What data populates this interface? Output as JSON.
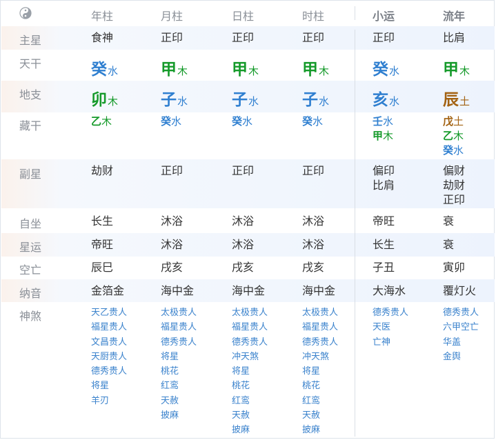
{
  "colors": {
    "water": "#2f7fd0",
    "wood": "#159a2a",
    "earth": "#a36212",
    "shensha": "#3a82cc",
    "label": "#8a8f97"
  },
  "header": {
    "icon": "yin-yang-icon",
    "year": "年柱",
    "month": "月柱",
    "day": "日柱",
    "hour": "时柱",
    "xiaoyun": "小运",
    "liunian": "流年"
  },
  "rows": {
    "zhuxing": "主星",
    "tiangan": "天干",
    "dizhi": "地支",
    "canggan": "藏干",
    "fuxing": "副星",
    "zizuo": "自坐",
    "xingyun": "星运",
    "kongwang": "空亡",
    "nayin": "纳音",
    "shensha": "神煞"
  },
  "columns": [
    {
      "zhuxing": "食神",
      "gan": {
        "char": "癸",
        "el": "水",
        "color": "water"
      },
      "zhi": {
        "char": "卯",
        "el": "木",
        "color": "wood"
      },
      "canggan": [
        {
          "char": "乙",
          "el": "木",
          "color": "wood"
        }
      ],
      "fuxing": [
        "劫财"
      ],
      "zizuo": "长生",
      "xingyun": "帝旺",
      "kongwang": "辰巳",
      "nayin": "金箔金",
      "shensha": [
        "天乙贵人",
        "福星贵人",
        "文昌贵人",
        "天厨贵人",
        "德秀贵人",
        "将星",
        "羊刃"
      ]
    },
    {
      "zhuxing": "正印",
      "gan": {
        "char": "甲",
        "el": "木",
        "color": "wood"
      },
      "zhi": {
        "char": "子",
        "el": "水",
        "color": "water"
      },
      "canggan": [
        {
          "char": "癸",
          "el": "水",
          "color": "water"
        }
      ],
      "fuxing": [
        "正印"
      ],
      "zizuo": "沐浴",
      "xingyun": "沐浴",
      "kongwang": "戌亥",
      "nayin": "海中金",
      "shensha": [
        "太极贵人",
        "福星贵人",
        "德秀贵人",
        "将星",
        "桃花",
        "红鸾",
        "天赦",
        "披麻"
      ]
    },
    {
      "zhuxing": "正印",
      "gan": {
        "char": "甲",
        "el": "木",
        "color": "wood"
      },
      "zhi": {
        "char": "子",
        "el": "水",
        "color": "water"
      },
      "canggan": [
        {
          "char": "癸",
          "el": "水",
          "color": "water"
        }
      ],
      "fuxing": [
        "正印"
      ],
      "zizuo": "沐浴",
      "xingyun": "沐浴",
      "kongwang": "戌亥",
      "nayin": "海中金",
      "shensha": [
        "太极贵人",
        "福星贵人",
        "德秀贵人",
        "冲天煞",
        "将星",
        "桃花",
        "红鸾",
        "天赦",
        "披麻"
      ]
    },
    {
      "zhuxing": "正印",
      "gan": {
        "char": "甲",
        "el": "木",
        "color": "wood"
      },
      "zhi": {
        "char": "子",
        "el": "水",
        "color": "water"
      },
      "canggan": [
        {
          "char": "癸",
          "el": "水",
          "color": "water"
        }
      ],
      "fuxing": [
        "正印"
      ],
      "zizuo": "沐浴",
      "xingyun": "沐浴",
      "kongwang": "戌亥",
      "nayin": "海中金",
      "shensha": [
        "太极贵人",
        "福星贵人",
        "德秀贵人",
        "冲天煞",
        "将星",
        "桃花",
        "红鸾",
        "天赦",
        "披麻"
      ]
    },
    {
      "zhuxing": "正印",
      "gan": {
        "char": "癸",
        "el": "水",
        "color": "water"
      },
      "zhi": {
        "char": "亥",
        "el": "水",
        "color": "water"
      },
      "canggan": [
        {
          "char": "壬",
          "el": "水",
          "color": "water"
        },
        {
          "char": "甲",
          "el": "木",
          "color": "wood"
        }
      ],
      "fuxing": [
        "偏印",
        "比肩"
      ],
      "zizuo": "帝旺",
      "xingyun": "长生",
      "kongwang": "子丑",
      "nayin": "大海水",
      "shensha": [
        "德秀贵人",
        "天医",
        "亡神"
      ]
    },
    {
      "zhuxing": "比肩",
      "gan": {
        "char": "甲",
        "el": "木",
        "color": "wood"
      },
      "zhi": {
        "char": "辰",
        "el": "土",
        "color": "earth"
      },
      "canggan": [
        {
          "char": "戊",
          "el": "土",
          "color": "earth"
        },
        {
          "char": "乙",
          "el": "木",
          "color": "wood"
        },
        {
          "char": "癸",
          "el": "水",
          "color": "water"
        }
      ],
      "fuxing": [
        "偏财",
        "劫财",
        "正印"
      ],
      "zizuo": "衰",
      "xingyun": "衰",
      "kongwang": "寅卯",
      "nayin": "覆灯火",
      "shensha": [
        "德秀贵人",
        "六甲空亡",
        "华盖",
        "金舆"
      ]
    }
  ]
}
